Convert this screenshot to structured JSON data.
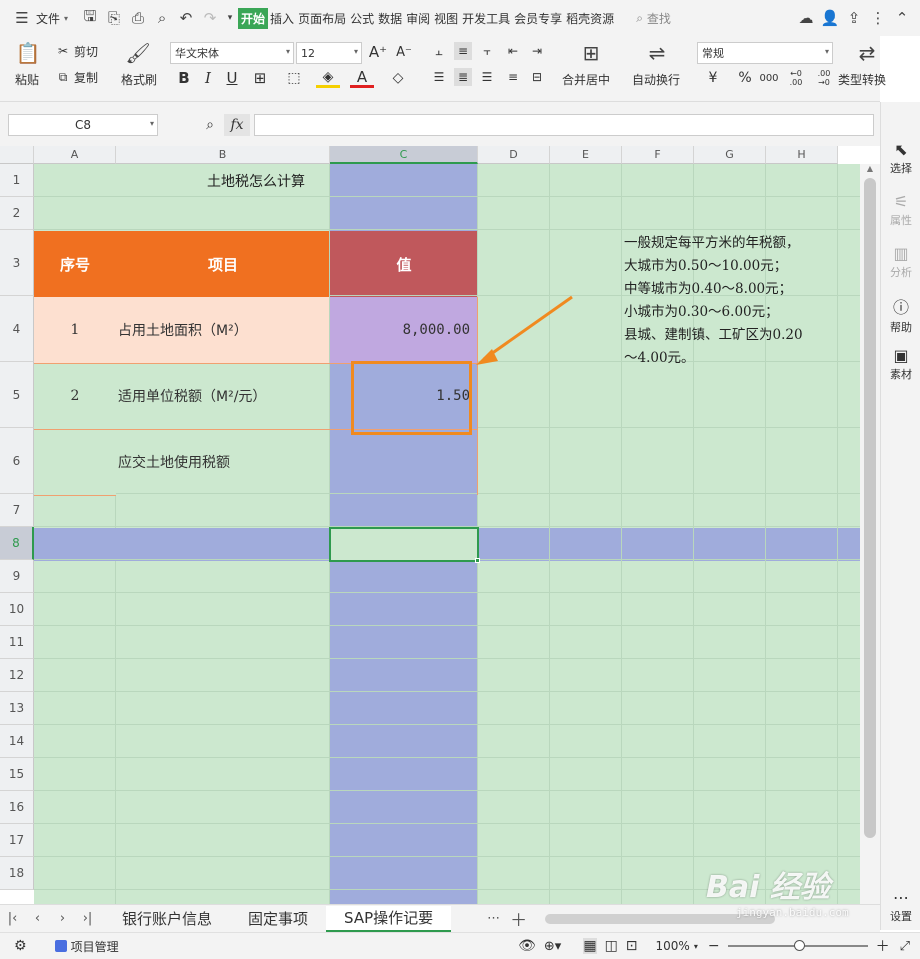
{
  "menu": {
    "file": "文件",
    "tabs": [
      "开始",
      "插入",
      "页面布局",
      "公式",
      "数据",
      "审阅",
      "视图",
      "开发工具",
      "会员专享",
      "稻壳资源"
    ],
    "search": "查找"
  },
  "ribbon": {
    "paste": "粘贴",
    "cut": "剪切",
    "copy": "复制",
    "format_painter": "格式刷",
    "font": "华文宋体",
    "font_size": "12",
    "bold": "B",
    "italic": "I",
    "underline": "U",
    "merge": "合并居中",
    "wrap": "自动换行",
    "number_format": "常规",
    "type_convert": "类型转换",
    "currency": "¥",
    "percent": "%",
    "thousands": "000",
    "inc_dec": "←0 .00",
    "dec_dec": ".00 →0"
  },
  "formula": {
    "cell_ref": "C8",
    "fx": "fx",
    "value": ""
  },
  "columns": [
    "A",
    "B",
    "C",
    "D",
    "E",
    "F",
    "G",
    "H"
  ],
  "rows": [
    "1",
    "2",
    "3",
    "4",
    "5",
    "6",
    "7",
    "8",
    "9",
    "10",
    "11",
    "12",
    "13",
    "14",
    "15",
    "16",
    "17",
    "18"
  ],
  "cells": {
    "b1": "土地税怎么计算",
    "a3": "序号",
    "b3": "项目",
    "c3": "值",
    "a4": "1",
    "b4": "占用土地面积（M²）",
    "c4": "8,000.00",
    "a5": "2",
    "b5": "适用单位税额（M²/元）",
    "c5": "1.50",
    "b6": "应交土地使用税额"
  },
  "note": {
    "lines": [
      "一般规定每平方米的年税额，",
      "大城市为0.50～10.00元；",
      "中等城市为0.40～8.00元；",
      "小城市为0.30～6.00元；",
      "县城、建制镇、工矿区为0.20",
      "～4.00元。"
    ]
  },
  "right_panel": {
    "select": "选择",
    "properties": "属性",
    "analysis": "分析",
    "help": "帮助",
    "assets": "素材",
    "settings": "设置"
  },
  "sheets": [
    "银行账户信息",
    "固定事项",
    "SAP操作记要"
  ],
  "status": {
    "project": "项目管理",
    "zoom": "100%"
  },
  "watermark": {
    "text": "Bai 经验",
    "url": "jingyan.baidu.com"
  },
  "colors": {
    "green": "#cce8cf",
    "blue": "#a0acdc",
    "orange": "#f07020",
    "header_c": "#c0585c",
    "peach": "#fde0d0",
    "lavender": "#c0a8e0",
    "arrow": "#f08a20"
  }
}
